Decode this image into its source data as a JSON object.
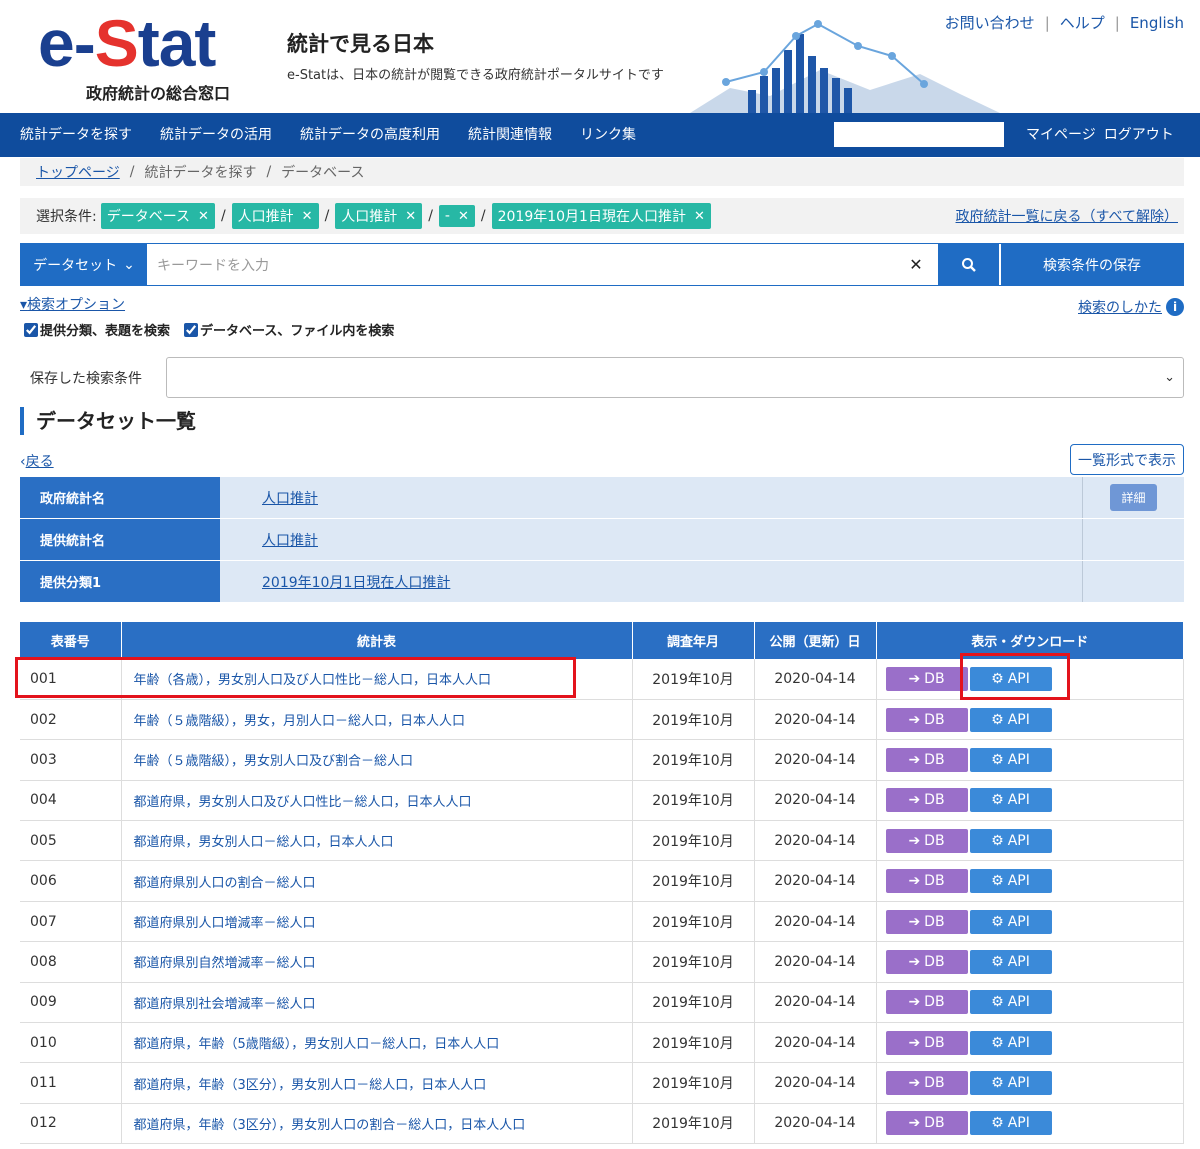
{
  "header": {
    "logo_main": "e-",
    "logo_s": "S",
    "logo_rest": "tat",
    "logo_sub": "政府統計の総合窓口",
    "title": "統計で見る日本",
    "description": "e-Statは、日本の統計が閲覧できる政府統計ポータルサイトです",
    "links": [
      "お問い合わせ",
      "ヘルプ",
      "English"
    ]
  },
  "nav": {
    "items": [
      "統計データを探す",
      "統計データの活用",
      "統計データの高度利用",
      "統計関連情報",
      "リンク集"
    ],
    "mypage": "マイページ",
    "logout": "ログアウト"
  },
  "breadcrumb": [
    "トップページ",
    "統計データを探す",
    "データベース"
  ],
  "filters": {
    "label": "選択条件:",
    "chips": [
      "データベース",
      "人口推計",
      "人口推計",
      "-",
      "2019年10月1日現在人口推計"
    ],
    "clear_link": "政府統計一覧に戻る（すべて解除）"
  },
  "search": {
    "type_label": "データセット",
    "placeholder": "キーワードを入力",
    "save_label": "検索条件の保存",
    "options_label": "検索オプション",
    "how_to": "検索のしかた",
    "check1": "提供分類、表題を検索",
    "check2": "データベース、ファイル内を検索",
    "saved_label": "保存した検索条件"
  },
  "section": {
    "title": "データセット一覧",
    "back": "戻る",
    "list_view": "一覧形式で表示"
  },
  "info": [
    {
      "key": "政府統計名",
      "value": "人口推計",
      "detail": "詳細"
    },
    {
      "key": "提供統計名",
      "value": "人口推計"
    },
    {
      "key": "提供分類1",
      "value": "2019年10月1日現在人口推計"
    }
  ],
  "table": {
    "headers": [
      "表番号",
      "統計表",
      "調査年月",
      "公開（更新）日",
      "表示・ダウンロード"
    ],
    "db_label": "DB",
    "api_label": "API",
    "rows": [
      {
        "no": "001",
        "title": "年齢（各歳），男女別人口及び人口性比－総人口，日本人人口",
        "date": "2019年10月",
        "pub": "2020-04-14"
      },
      {
        "no": "002",
        "title": "年齢（５歳階級），男女，月別人口－総人口，日本人人口",
        "date": "2019年10月",
        "pub": "2020-04-14"
      },
      {
        "no": "003",
        "title": "年齢（５歳階級），男女別人口及び割合－総人口",
        "date": "2019年10月",
        "pub": "2020-04-14"
      },
      {
        "no": "004",
        "title": "都道府県，男女別人口及び人口性比－総人口，日本人人口",
        "date": "2019年10月",
        "pub": "2020-04-14"
      },
      {
        "no": "005",
        "title": "都道府県，男女別人口－総人口，日本人人口",
        "date": "2019年10月",
        "pub": "2020-04-14"
      },
      {
        "no": "006",
        "title": "都道府県別人口の割合－総人口",
        "date": "2019年10月",
        "pub": "2020-04-14"
      },
      {
        "no": "007",
        "title": "都道府県別人口増減率－総人口",
        "date": "2019年10月",
        "pub": "2020-04-14"
      },
      {
        "no": "008",
        "title": "都道府県別自然増減率－総人口",
        "date": "2019年10月",
        "pub": "2020-04-14"
      },
      {
        "no": "009",
        "title": "都道府県別社会増減率－総人口",
        "date": "2019年10月",
        "pub": "2020-04-14"
      },
      {
        "no": "010",
        "title": "都道府県，年齢（5歳階級），男女別人口－総人口，日本人人口",
        "date": "2019年10月",
        "pub": "2020-04-14"
      },
      {
        "no": "011",
        "title": "都道府県，年齢（3区分），男女別人口－総人口，日本人人口",
        "date": "2019年10月",
        "pub": "2020-04-14"
      },
      {
        "no": "012",
        "title": "都道府県，年齢（3区分），男女別人口の割合－総人口，日本人人口",
        "date": "2019年10月",
        "pub": "2020-04-14"
      }
    ]
  },
  "colors": {
    "nav_bg": "#0f4c9d",
    "accent": "#2a6fc4",
    "chip": "#27b8a5",
    "db_btn": "#9a6fc9",
    "api_btn": "#3b8ad9",
    "highlight": "#e3131c"
  }
}
